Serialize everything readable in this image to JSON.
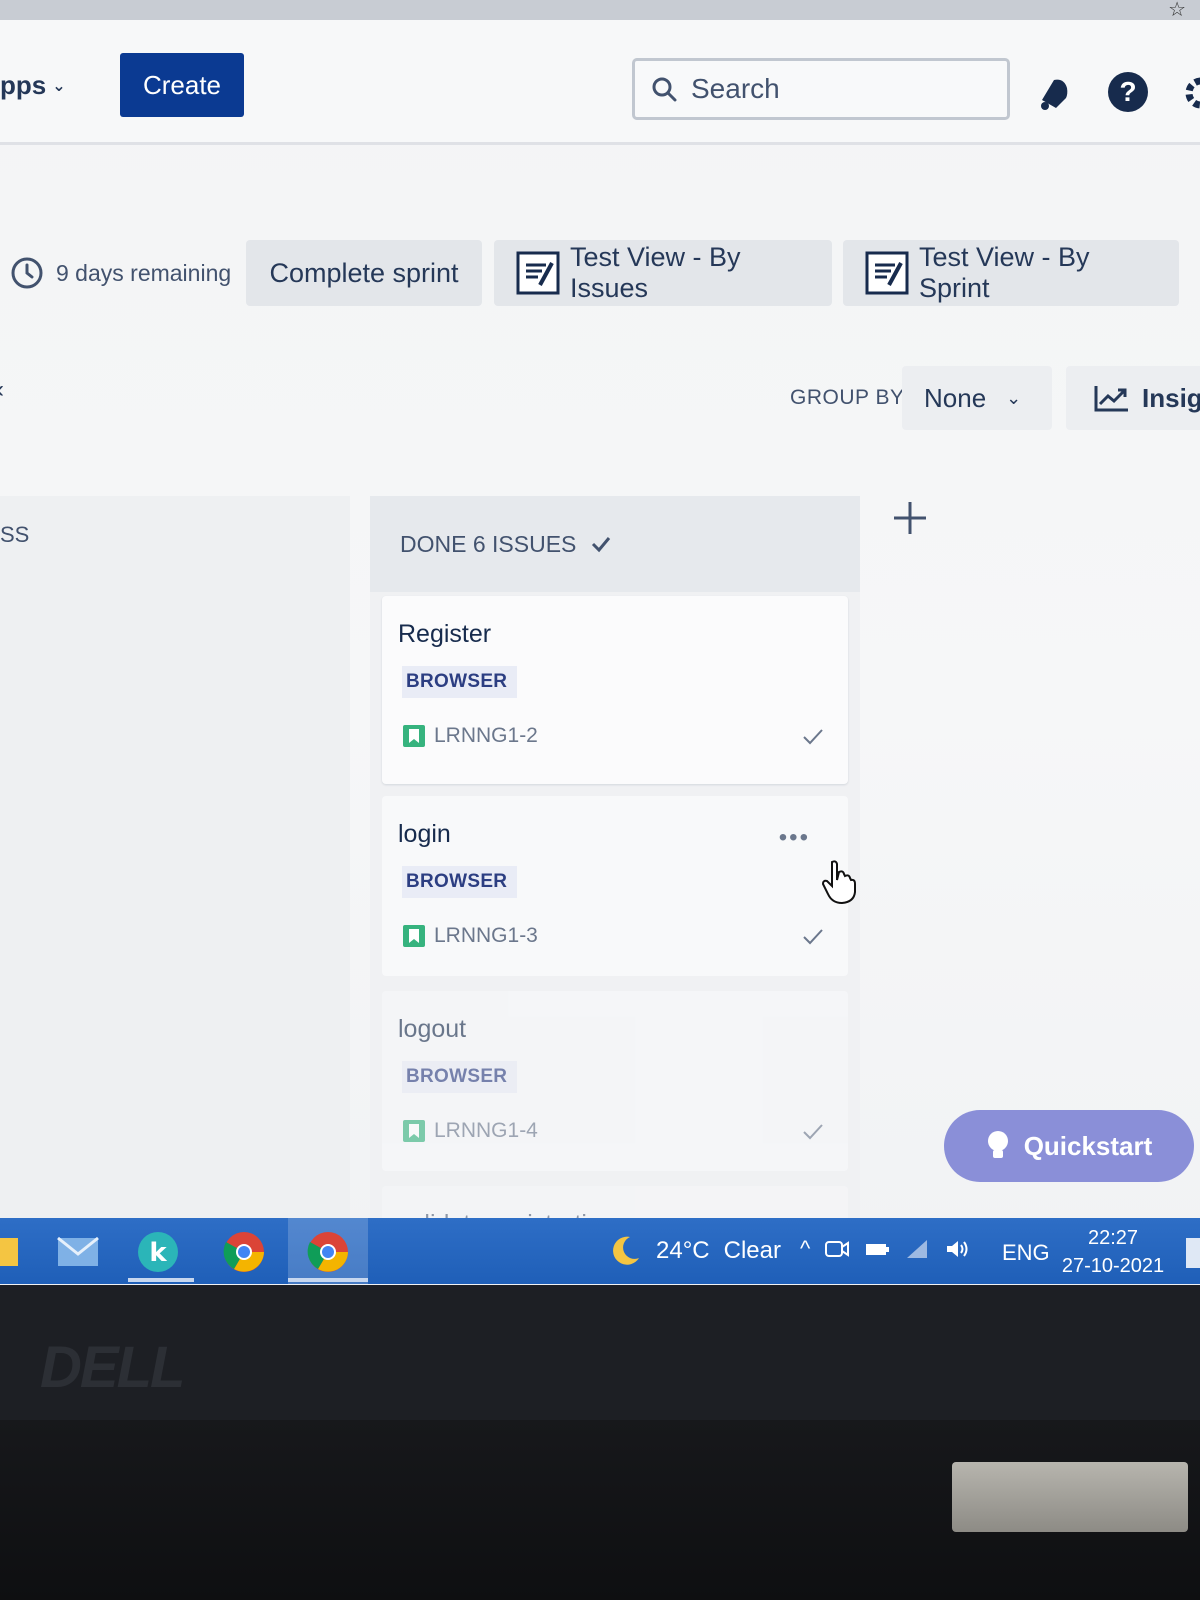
{
  "nav": {
    "apps_label": "pps",
    "create_label": "Create",
    "search_placeholder": "Search"
  },
  "sprint": {
    "days_remaining": "9 days remaining",
    "complete_sprint": "Complete sprint",
    "test_view_issues": "Test View - By Issues",
    "test_view_sprint": "Test View - By Sprint"
  },
  "toolbar": {
    "group_by_label": "GROUP BY",
    "group_by_value": "None",
    "insights_label": "Insig"
  },
  "board": {
    "prev_column_label": "SS",
    "done_column": {
      "title": "DONE 6 ISSUES"
    },
    "cards": [
      {
        "title": "Register",
        "label": "BROWSER",
        "key": "LRNNG1-2"
      },
      {
        "title": "login",
        "label": "BROWSER",
        "key": "LRNNG1-3"
      },
      {
        "title": "logout",
        "label": "BROWSER",
        "key": "LRNNG1-4"
      },
      {
        "title": "validate registration"
      }
    ]
  },
  "quickstart_label": "Quickstart",
  "taskbar": {
    "weather_temp": "24°C",
    "weather_desc": "Clear",
    "language": "ENG",
    "time": "22:27",
    "date": "27-10-2021"
  },
  "bezel": {
    "brand": "DELL"
  },
  "colors": {
    "create_button": "#0b3a92",
    "label_bg": "#e9ecf6",
    "label_text": "#2c3e82",
    "story_icon": "#36b37e",
    "quickstart": "#8a8fd8",
    "taskbar": "#2e6ec6"
  }
}
